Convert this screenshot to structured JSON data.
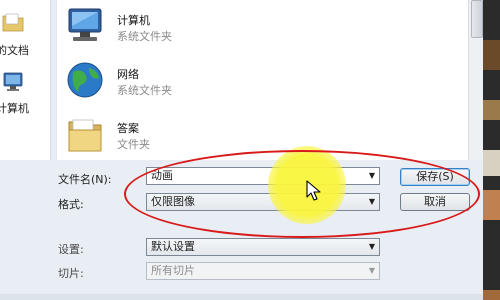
{
  "nav": {
    "items": [
      {
        "label": "的文档",
        "icon": "documents-folder-icon"
      },
      {
        "label": "计算机",
        "icon": "computer-icon"
      }
    ]
  },
  "files": [
    {
      "name": "计算机",
      "type": "系统文件夹",
      "icon": "computer-icon"
    },
    {
      "name": "网络",
      "type": "系统文件夹",
      "icon": "network-globe-icon"
    },
    {
      "name": "答案",
      "type": "文件夹",
      "icon": "folder-icon"
    }
  ],
  "form": {
    "filename_label": "文件名(N):",
    "filename_value": "动画",
    "format_label": "格式:",
    "format_value": "仅限图像",
    "settings_label": "设置:",
    "settings_value": "默认设置",
    "slices_label": "切片:",
    "slices_value": "所有切片"
  },
  "buttons": {
    "save": "保存(S)",
    "cancel": "取消"
  },
  "colors": {
    "highlight": "#d81a1a",
    "cursor_halo": "#faf53c"
  }
}
